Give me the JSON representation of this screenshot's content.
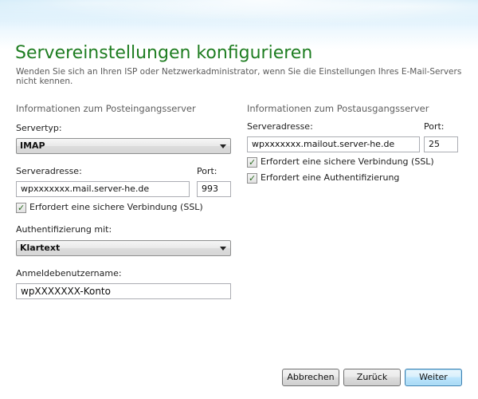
{
  "dialog": {
    "title": "Servereinstellungen konfigurieren",
    "subtitle": "Wenden Sie sich an Ihren ISP oder Netzwerkadministrator, wenn Sie die Einstellungen Ihres E-Mail-Servers nicht kennen."
  },
  "incoming": {
    "section_title": "Informationen zum Posteingangsserver",
    "server_type_label": "Servertyp:",
    "server_type_value": "IMAP",
    "server_address_label": "Serveradresse:",
    "server_address_value": "wpxxxxxxx.mail.server-he.de",
    "port_label": "Port:",
    "port_value": "993",
    "ssl_label": "Erfordert eine sichere Verbindung (SSL)",
    "ssl_checked": true,
    "auth_label": "Authentifizierung mit:",
    "auth_value": "Klartext",
    "username_label": "Anmeldebenutzername:",
    "username_value": "wpXXXXXXX-Konto"
  },
  "outgoing": {
    "section_title": "Informationen zum Postausgangsserver",
    "server_address_label": "Serveradresse:",
    "server_address_value": "wpxxxxxxx.mailout.server-he.de",
    "port_label": "Port:",
    "port_value": "25",
    "ssl_label": "Erfordert eine sichere Verbindung (SSL)",
    "ssl_checked": true,
    "auth_required_label": "Erfordert eine Authentifizierung",
    "auth_required_checked": true
  },
  "buttons": {
    "cancel": "Abbrechen",
    "back": "Zurück",
    "next": "Weiter"
  },
  "colors": {
    "title_green": "#1e7d21",
    "header_blue": "#bfe3f6"
  },
  "icons": {
    "dropdown": "chevron-down-icon",
    "check": "checkmark-icon"
  }
}
